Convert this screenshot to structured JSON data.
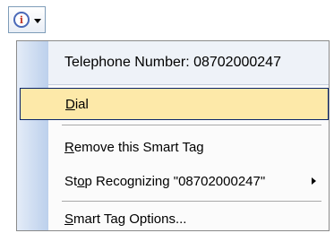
{
  "smart_tag": {
    "icon": "info-icon",
    "icon_glyph": "i"
  },
  "menu": {
    "header": "Telephone Number: 08702000247",
    "items": [
      {
        "label": "Dial",
        "accel": "D",
        "rest": "ial"
      },
      {
        "label": "Remove this Smart Tag",
        "accel": "R",
        "rest": "emove this Smart Tag"
      },
      {
        "label": "Stop Recognizing \"08702000247\"",
        "pre": "St",
        "accel": "o",
        "rest": "p Recognizing \"08702000247\""
      },
      {
        "label": "Smart Tag Options...",
        "accel": "S",
        "rest": "mart Tag Options..."
      }
    ]
  },
  "colors": {
    "highlight": "#fde9a9",
    "highlight_border": "#0a246a",
    "gutter": "#bcd0ec"
  }
}
